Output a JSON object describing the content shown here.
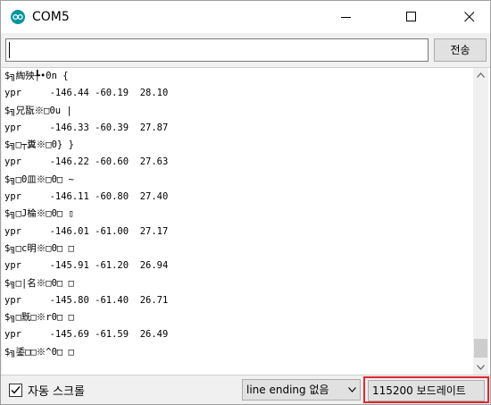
{
  "window": {
    "title": "COM5",
    "icon": "arduino-icon",
    "controls": [
      "minimize-icon",
      "maximize-icon",
      "close-icon"
    ]
  },
  "input": {
    "value": "",
    "send_label": "전송"
  },
  "output": {
    "lines": [
      "$╗綯殃╄•0n {",
      "ypr     -146.44 -60.19  28.10",
      "$╗兄翫※□0u |",
      "ypr     -146.33 -60.39  27.87",
      "$╗□┬糞※□0} }",
      "ypr     -146.22 -60.60  27.63",
      "$╗□0皿※□0□ ~",
      "ypr     -146.11 -60.80  27.40",
      "$╗□J棆※□0□ ▯",
      "ypr     -146.01 -61.00  27.17",
      "$╗□c明※□0□ □",
      "ypr     -145.91 -61.20  26.94",
      "$╗□|名※□0□ □",
      "ypr     -145.80 -61.40  26.71",
      "$╗□黖□※r0□ □",
      "ypr     -145.69 -61.59  26.49",
      "$╗鋈□□※^0□ □"
    ]
  },
  "footer": {
    "autoscroll_label": "자동 스크롤",
    "autoscroll_checked": true,
    "line_ending": "line ending 없음",
    "baud_rate": "115200 보드레이트",
    "highlight_color": "#e0282e"
  }
}
